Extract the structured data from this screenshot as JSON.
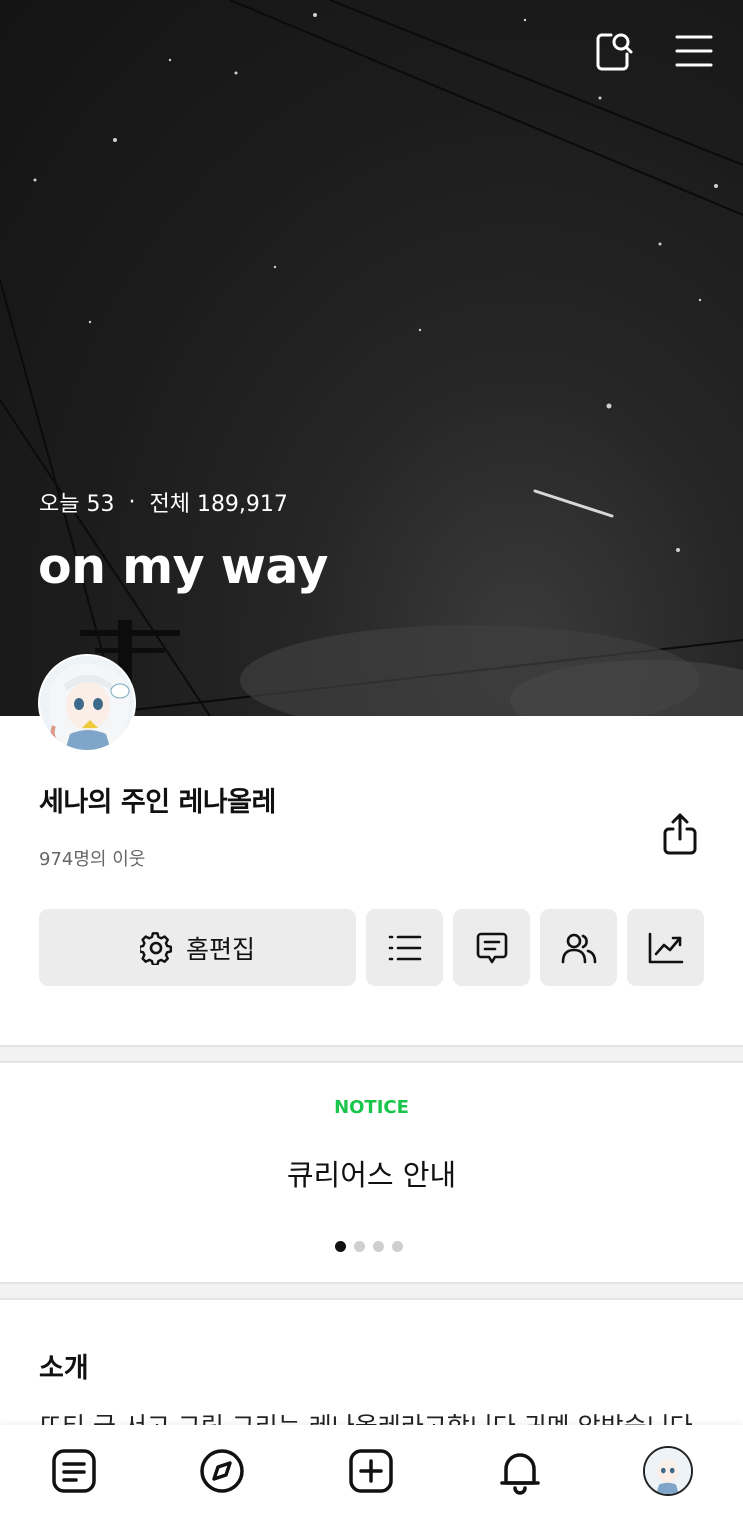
{
  "hero": {
    "visitors_today_label": "오늘 53",
    "separator": "·",
    "visitors_total_label": "전체 189,917",
    "blog_title": "on my way"
  },
  "header_icons": [
    "search-icon",
    "menu-icon"
  ],
  "profile": {
    "owner_name": "세나의 주인 레나올레",
    "neighbors": "974명의 이웃"
  },
  "actions": {
    "edit_home_label": "홈편집",
    "icons": [
      "list-icon",
      "guestbook-icon",
      "neighbors-icon",
      "stats-icon"
    ]
  },
  "notice": {
    "label": "NOTICE",
    "title": "큐리어스 안내",
    "page_count": 4,
    "active_page": 1
  },
  "intro": {
    "heading": "소개",
    "text": "뜨티 굿 서고 그림 그리는 레나올레라고합니다 귀멘 앙방습니다"
  },
  "colors": {
    "accent_green": "#19c54a",
    "hero_bg": "#1c1c1c"
  },
  "bottom_nav": [
    "feed-icon",
    "discover-icon",
    "write-icon",
    "notification-icon",
    "my-avatar"
  ]
}
